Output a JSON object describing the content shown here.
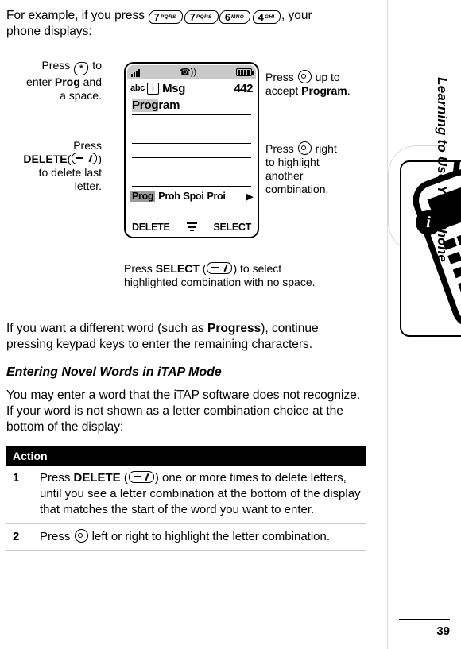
{
  "intro": {
    "before_keys": "For example, if you press ",
    "keys": [
      {
        "digit": "7",
        "letters": "PQRS"
      },
      {
        "digit": "7",
        "letters": "PQRS"
      },
      {
        "digit": "6",
        "letters": "MNO"
      },
      {
        "digit": "4",
        "letters": "GHI"
      }
    ],
    "after_keys": ", your",
    "line2": "phone displays:"
  },
  "figure": {
    "callout_left_top": {
      "line1": "Press ",
      "star": "*",
      "line1b": " to",
      "line2a": "enter ",
      "prog": "Prog",
      "line2b": " and",
      "line3": "a space."
    },
    "callout_left_bottom": {
      "line1": "Press",
      "delete": "DELETE",
      "paren_open": "(",
      "paren_close": ")",
      "line3": "to delete last",
      "line4": "letter."
    },
    "callout_right_top": {
      "line1": "Press ",
      "line1b": " up to",
      "line2a": "accept ",
      "program": "Program",
      "line2b": "."
    },
    "callout_right_bottom": {
      "line1": "Press ",
      "line1b": " right",
      "line2": "to highlight",
      "line3": "another",
      "line4": "combination."
    },
    "callout_bottom": {
      "line1a": "Press ",
      "select": "SELECT",
      "line1b": " (",
      "line1c": ") to select",
      "line2": "highlighted combination with no space."
    },
    "phone": {
      "mode_indicator": "abc",
      "icon_letter": "i",
      "title": "Msg",
      "count": "442",
      "word_selected": "Prog",
      "word_rest": "ram",
      "choices": [
        "Prog",
        "Proh",
        "Spoi",
        "Proi"
      ],
      "choice_highlighted": "Prog",
      "softkey_left": "DELETE",
      "softkey_right": "SELECT"
    }
  },
  "body": {
    "para1a": "If you want a different word (such as ",
    "para1_bold": "Progress",
    "para1b": "), continue",
    "para1c": "pressing keypad keys to enter the remaining characters.",
    "section_heading": "Entering Novel Words in iTAP Mode",
    "para2": "You may enter a word that the iTAP software does not recognize. If your word is not shown as a letter combination choice at the bottom of the display:"
  },
  "table": {
    "header": "Action",
    "rows": [
      {
        "num": "1",
        "text_a": "Press ",
        "bold": "DELETE",
        "text_b": " (",
        "text_c": ") one or more times to delete letters, until you see a letter combination at the bottom of the display that matches the start of the word you want to enter."
      },
      {
        "num": "2",
        "text_a": "Press ",
        "text_b": " left or right to highlight the letter combination."
      }
    ]
  },
  "rail": {
    "title": "Learning to Use Your Phone",
    "page_number": "39"
  }
}
